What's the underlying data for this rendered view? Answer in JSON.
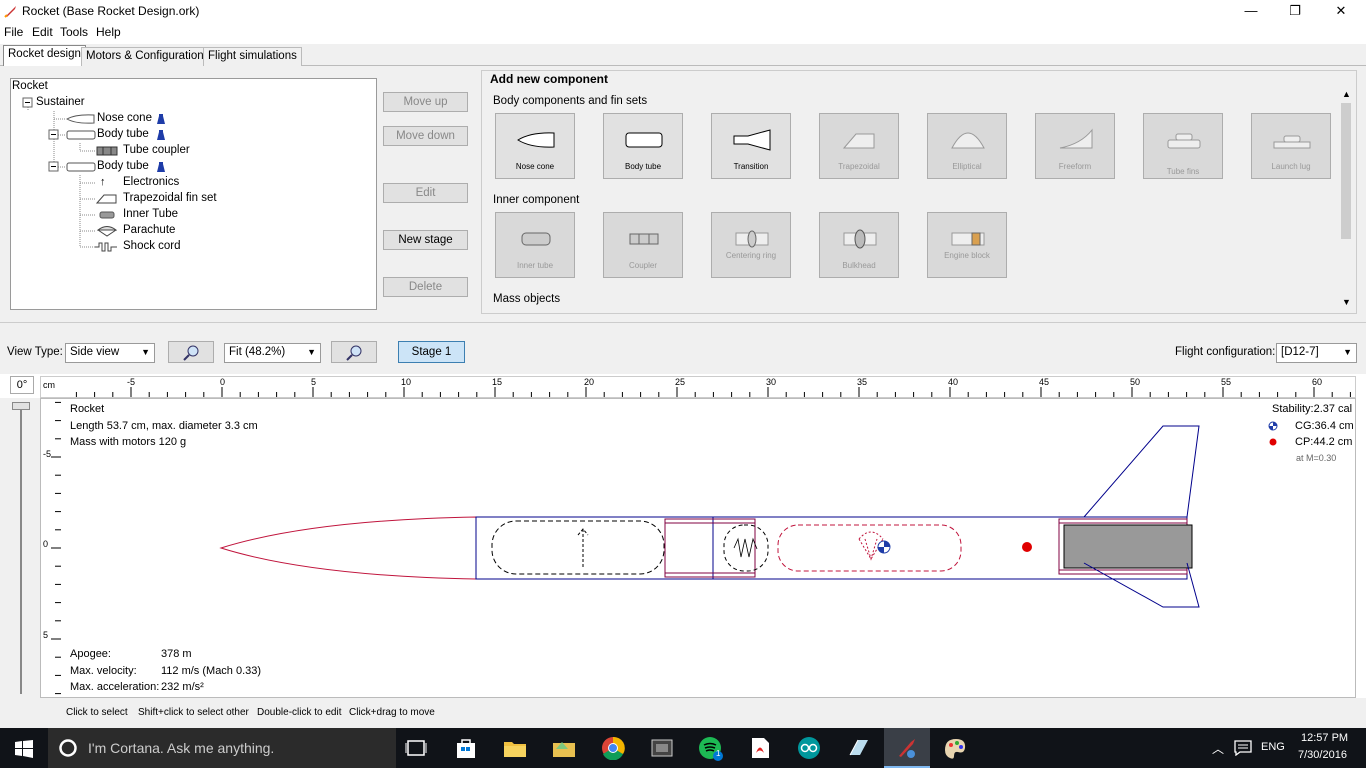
{
  "window": {
    "title": "Rocket (Base Rocket Design.ork)",
    "minimize": "—",
    "maximize": "❐",
    "close": "✕"
  },
  "menu": [
    "File",
    "Edit",
    "Tools",
    "Help"
  ],
  "tabs": [
    "Rocket design",
    "Motors & Configuration",
    "Flight simulations"
  ],
  "tree": {
    "root": "Rocket",
    "items": [
      {
        "label": "Sustainer"
      },
      {
        "label": "Nose cone"
      },
      {
        "label": "Body tube"
      },
      {
        "label": "Tube coupler"
      },
      {
        "label": "Body tube"
      },
      {
        "label": "Electronics"
      },
      {
        "label": "Trapezoidal fin set"
      },
      {
        "label": "Inner Tube"
      },
      {
        "label": "Parachute"
      },
      {
        "label": "Shock cord"
      }
    ]
  },
  "tree_buttons": {
    "move_up": "Move up",
    "move_down": "Move down",
    "edit": "Edit",
    "new_stage": "New stage",
    "delete": "Delete"
  },
  "add_component": {
    "title": "Add new component",
    "body_section": "Body components and fin sets",
    "body": [
      "Nose cone",
      "Body tube",
      "Transition",
      "Trapezoidal",
      "Elliptical",
      "Freeform",
      "Tube fins",
      "Launch lug"
    ],
    "inner_section": "Inner component",
    "inner": [
      "Inner tube",
      "Coupler",
      "Centering ring",
      "Bulkhead",
      "Engine block"
    ],
    "mass_section": "Mass objects"
  },
  "view": {
    "view_type_label": "View Type:",
    "view_type": "Side view",
    "zoom": "Fit (48.2%)",
    "stage": "Stage 1",
    "flight_config_label": "Flight configuration:",
    "flight_config": "[D12-7]",
    "angle": "0°",
    "ruler_unit": "cm",
    "ruler_ticks": [
      "-5",
      "0",
      "5",
      "10",
      "15",
      "20",
      "25",
      "30",
      "35",
      "40",
      "45",
      "50",
      "55",
      "60"
    ],
    "vruler_ticks": [
      "-5",
      "0",
      "5"
    ]
  },
  "rocket_info": {
    "name": "Rocket",
    "length": "Length 53.7 cm, max. diameter 3.3 cm",
    "mass": "Mass with motors 120 g",
    "stability": "Stability:2.37 cal",
    "cg": "CG:36.4 cm",
    "cp": "CP:44.2 cm",
    "mach": "at M=0.30"
  },
  "flight_info": {
    "apogee_label": "Apogee:",
    "apogee": "378 m",
    "velocity_label": "Max. velocity:",
    "velocity": "112 m/s  (Mach 0.33)",
    "accel_label": "Max. acceleration:",
    "accel": "232 m/s²"
  },
  "hints": [
    "Click to select",
    "Shift+click to select other",
    "Double-click to edit",
    "Click+drag to move"
  ],
  "taskbar": {
    "search": "I'm Cortana. Ask me anything.",
    "lang": "ENG",
    "time": "12:57 PM",
    "date": "7/30/2016",
    "spotify_badge": "1"
  },
  "colors": {
    "accent": "#0078d7",
    "rocket_outline": "#00008b",
    "nosecone": "#c0143c",
    "cp": "#e00000"
  }
}
